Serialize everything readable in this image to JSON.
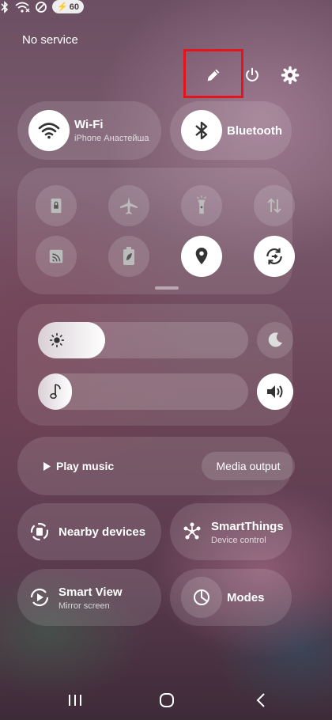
{
  "status": {
    "carrier": "No service",
    "battery": "60"
  },
  "tiles": {
    "wifi": {
      "title": "Wi-Fi",
      "subtitle": "iPhone Анастейша"
    },
    "bluetooth": {
      "title": "Bluetooth"
    }
  },
  "sliders": {
    "brightness_level": 0.32,
    "volume_level": 0.16
  },
  "media": {
    "play_label": "Play music",
    "output_label": "Media output"
  },
  "cards": {
    "nearby": {
      "title": "Nearby devices"
    },
    "smartthings": {
      "title": "SmartThings",
      "subtitle": "Device control"
    },
    "smartview": {
      "title": "Smart View",
      "subtitle": "Mirror screen"
    },
    "modes": {
      "title": "Modes"
    }
  },
  "colors": {
    "highlight": "#e3151b",
    "active_tile": "#ffffff"
  }
}
